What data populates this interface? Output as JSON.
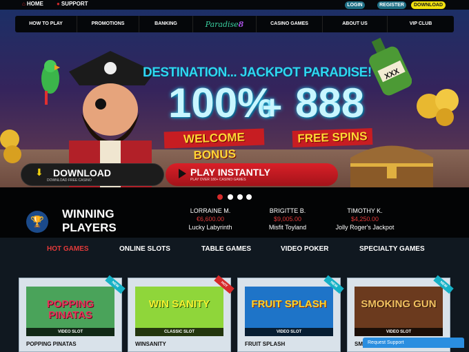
{
  "topbar": {
    "home_label": "HOME",
    "support_label": "SUPPORT",
    "login_label": "LOGIN",
    "register_label": "REGISTER",
    "download_label": "DOWNLOAD"
  },
  "nav": {
    "items_left": [
      "HOW TO PLAY",
      "PROMOTIONS",
      "BANKING"
    ],
    "logo_text": "Paradise",
    "logo_number": "8",
    "items_right": [
      "CASINO GAMES",
      "ABOUT US",
      "VIP CLUB"
    ]
  },
  "hero": {
    "headline": "DESTINATION... JACKPOT PARADISE!",
    "percent": "100%",
    "plus": "+",
    "spins_number": "888",
    "welcome_bonus": "WELCOME BONUS",
    "free_spins": "FREE SPINS",
    "download_button": "DOWNLOAD",
    "download_sub": "DOWNLOAD FREE CASINO",
    "play_button": "PLAY INSTANTLY",
    "play_sub": "PLAY OVER 180+ CASINO GAMES",
    "bottle_label": "XXX"
  },
  "carousel": {
    "slide_count": 4,
    "active_index": 0
  },
  "winners": {
    "title": "WINNING PLAYERS",
    "list": [
      {
        "name": "LORRAINE M.",
        "amount": "€6,600.00",
        "game": "Lucky Labyrinth"
      },
      {
        "name": "BRIGITTE B.",
        "amount": "$9,005.00",
        "game": "Misfit Toyland"
      },
      {
        "name": "TIMOTHY K.",
        "amount": "$4,250.00",
        "game": "Jolly Roger's Jackpot"
      }
    ]
  },
  "games": {
    "tabs": [
      "HOT GAMES",
      "ONLINE SLOTS",
      "TABLE GAMES",
      "VIDEO POKER",
      "SPECIALTY GAMES"
    ],
    "active_tab": "HOT GAMES",
    "cards": [
      {
        "thumb_title": "POPPING PINATAS",
        "type": "VIDEO SLOT",
        "badge": "NEW",
        "name": "POPPING PINATAS",
        "bg": "#4aa35a",
        "title_color": "#e8325a"
      },
      {
        "thumb_title": "WIN SANITY",
        "type": "CLASSIC SLOT",
        "badge": "HOT",
        "name": "WINSANITY",
        "bg": "#8fd63a",
        "title_color": "#f4f030"
      },
      {
        "thumb_title": "FRUIT SPLASH",
        "type": "VIDEO SLOT",
        "badge": "NEW",
        "name": "FRUIT SPLASH",
        "bg": "#1e74c8",
        "title_color": "#ffd42a"
      },
      {
        "thumb_title": "SMOKING GUN",
        "type": "VIDEO SLOT",
        "badge": "NEW",
        "name": "SM",
        "bg": "#6b3a1e",
        "title_color": "#f0c060"
      }
    ]
  },
  "support_widget": {
    "label": "Request Support"
  },
  "colors": {
    "accent_red": "#d52a2a",
    "accent_cyan": "#2fd6f0",
    "download_yellow": "#f2e20f",
    "nav_bg": "#05070a"
  }
}
